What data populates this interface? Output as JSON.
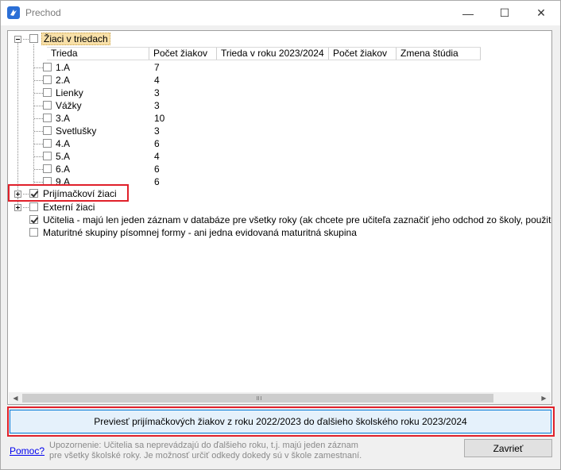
{
  "window": {
    "title": "Prechod",
    "minimize_symbol": "—",
    "maximize_symbol": "☐",
    "close_symbol": "✕"
  },
  "tree": {
    "root_label": "Žiaci v triedach",
    "columns": [
      "Trieda",
      "Počet žiakov",
      "Trieda v roku 2023/2024",
      "Počet žiakov",
      "Zmena štúdia"
    ],
    "classes": [
      {
        "name": "1.A",
        "count": "7"
      },
      {
        "name": "2.A",
        "count": "4"
      },
      {
        "name": "Lienky",
        "count": "3"
      },
      {
        "name": "Vážky",
        "count": "3"
      },
      {
        "name": "3.A",
        "count": "10"
      },
      {
        "name": "Svetlušky",
        "count": "3"
      },
      {
        "name": "4.A",
        "count": "6"
      },
      {
        "name": "5.A",
        "count": "4"
      },
      {
        "name": "6.A",
        "count": "6"
      },
      {
        "name": "9.A",
        "count": "6"
      }
    ],
    "prijimackovi_label": "Prijímačkoví žiaci",
    "externi_label": "Externí žiaci",
    "ucitelia_label": "Učitelia - majú len jeden záznam v databáze pre všetky roky (ak chcete pre učiteľa zaznačiť jeho odchod zo školy, použite pole 'Zam",
    "maturitne_label": "Maturitné skupiny písomnej formy - ani jedna evidovaná maturitná skupina"
  },
  "actions": {
    "transfer_button": "Previesť prijímačkových žiakov z roku 2022/2023 do ďalšieho školského roku 2023/2024",
    "help_link": "Pomoc?",
    "note_line1": "Upozornenie: Učitelia sa neprevádzajú do ďalšieho roku, t.j. majú jeden záznam",
    "note_line2": "pre všetky školské roky. Je možnosť určiť odkedy dokedy sú v škole zamestnaní.",
    "close_button": "Zavrieť"
  },
  "colors": {
    "highlight": "#e0202a",
    "selected_node": "#f8e0a8",
    "button_accent": "#0078d7"
  }
}
